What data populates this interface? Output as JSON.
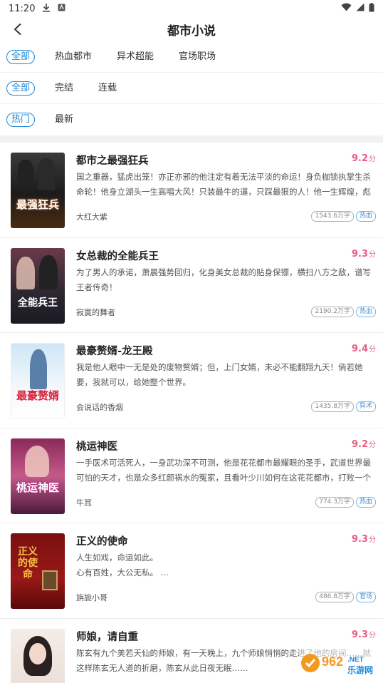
{
  "status_bar": {
    "time": "11:20"
  },
  "header": {
    "title": "都市小说"
  },
  "filters": [
    {
      "name": "category",
      "chips": [
        "全部",
        "热血都市",
        "异术超能",
        "官场职场"
      ],
      "active": 0
    },
    {
      "name": "status",
      "chips": [
        "全部",
        "完结",
        "连载"
      ],
      "active": 0
    },
    {
      "name": "sort",
      "chips": [
        "热门",
        "最新"
      ],
      "active": 0
    }
  ],
  "books": [
    {
      "title": "都市之最强狂兵",
      "score": "9.2",
      "score_unit": "分",
      "desc": "国之重器，猛虎出笼！亦正亦邪的他注定有着无法平淡的命运！身负枷锁执掌生杀命轮！他身立湖头一生高唱大风！只装最牛的逼，只踩最狠的人！他一生辉煌，彪悍铸就，舞...",
      "author": "大红大紫",
      "words": "1543.6万字",
      "category": "热血",
      "cover_text": "最强狂兵"
    },
    {
      "title": "女总裁的全能兵王",
      "score": "9.3",
      "score_unit": "分",
      "desc": "为了男人的承诺，萧晨强势回归，化身美女总裁的贴身保镖，横扫八方之敌，谱写王者传奇！",
      "author": "寂寞的舞者",
      "words": "2190.2万字",
      "category": "热血",
      "cover_text": "全能兵王"
    },
    {
      "title": "最豪赘婿-龙王殿",
      "score": "9.4",
      "score_unit": "分",
      "desc": "我是他人眼中一无是处的废物赘婿；但，上门女婿，未必不能翻翔九天！倘若她要，我就可以，给她整个世界。",
      "author": "会说话的香烟",
      "words": "1435.8万字",
      "category": "异术",
      "cover_text": "最豪赘婿"
    },
    {
      "title": "桃运神医",
      "score": "9.2",
      "score_unit": "分",
      "desc": "一手医术可活死人，一身武功深不可测，他是花花都市最耀眼的圣手，武道世界最可怕的天才，也是众多红颜祸水的冤家，且看叶少川如何在这花花都市，打败一个又一个敌人...",
      "author": "牛耳",
      "words": "774.3万字",
      "category": "热血",
      "cover_text": "桃运神医"
    },
    {
      "title": "正义的使命",
      "score": "9.3",
      "score_unit": "分",
      "desc": "人生如戏，命运如此。\n心有百姓，大公无私。 ...",
      "author": "旃旎小哥",
      "words": "486.8万字",
      "category": "官场",
      "cover_text": "正义的使命"
    },
    {
      "title": "师娘，请自重",
      "score": "9.3",
      "score_unit": "分",
      "desc": "陈玄有九个美若天仙的师娘，有一天晚上，九个师娘悄悄的走进了他的房间……就这样陈玄无人道的折磨，陈玄从此日夜无眠……",
      "author": "",
      "words": "",
      "category": "",
      "cover_text": ""
    }
  ],
  "watermark": {
    "number": "962",
    "suffix": ".NET",
    "site": "乐游网"
  },
  "colors": {
    "accent": "#1e88d8",
    "score": "#e85d84"
  }
}
